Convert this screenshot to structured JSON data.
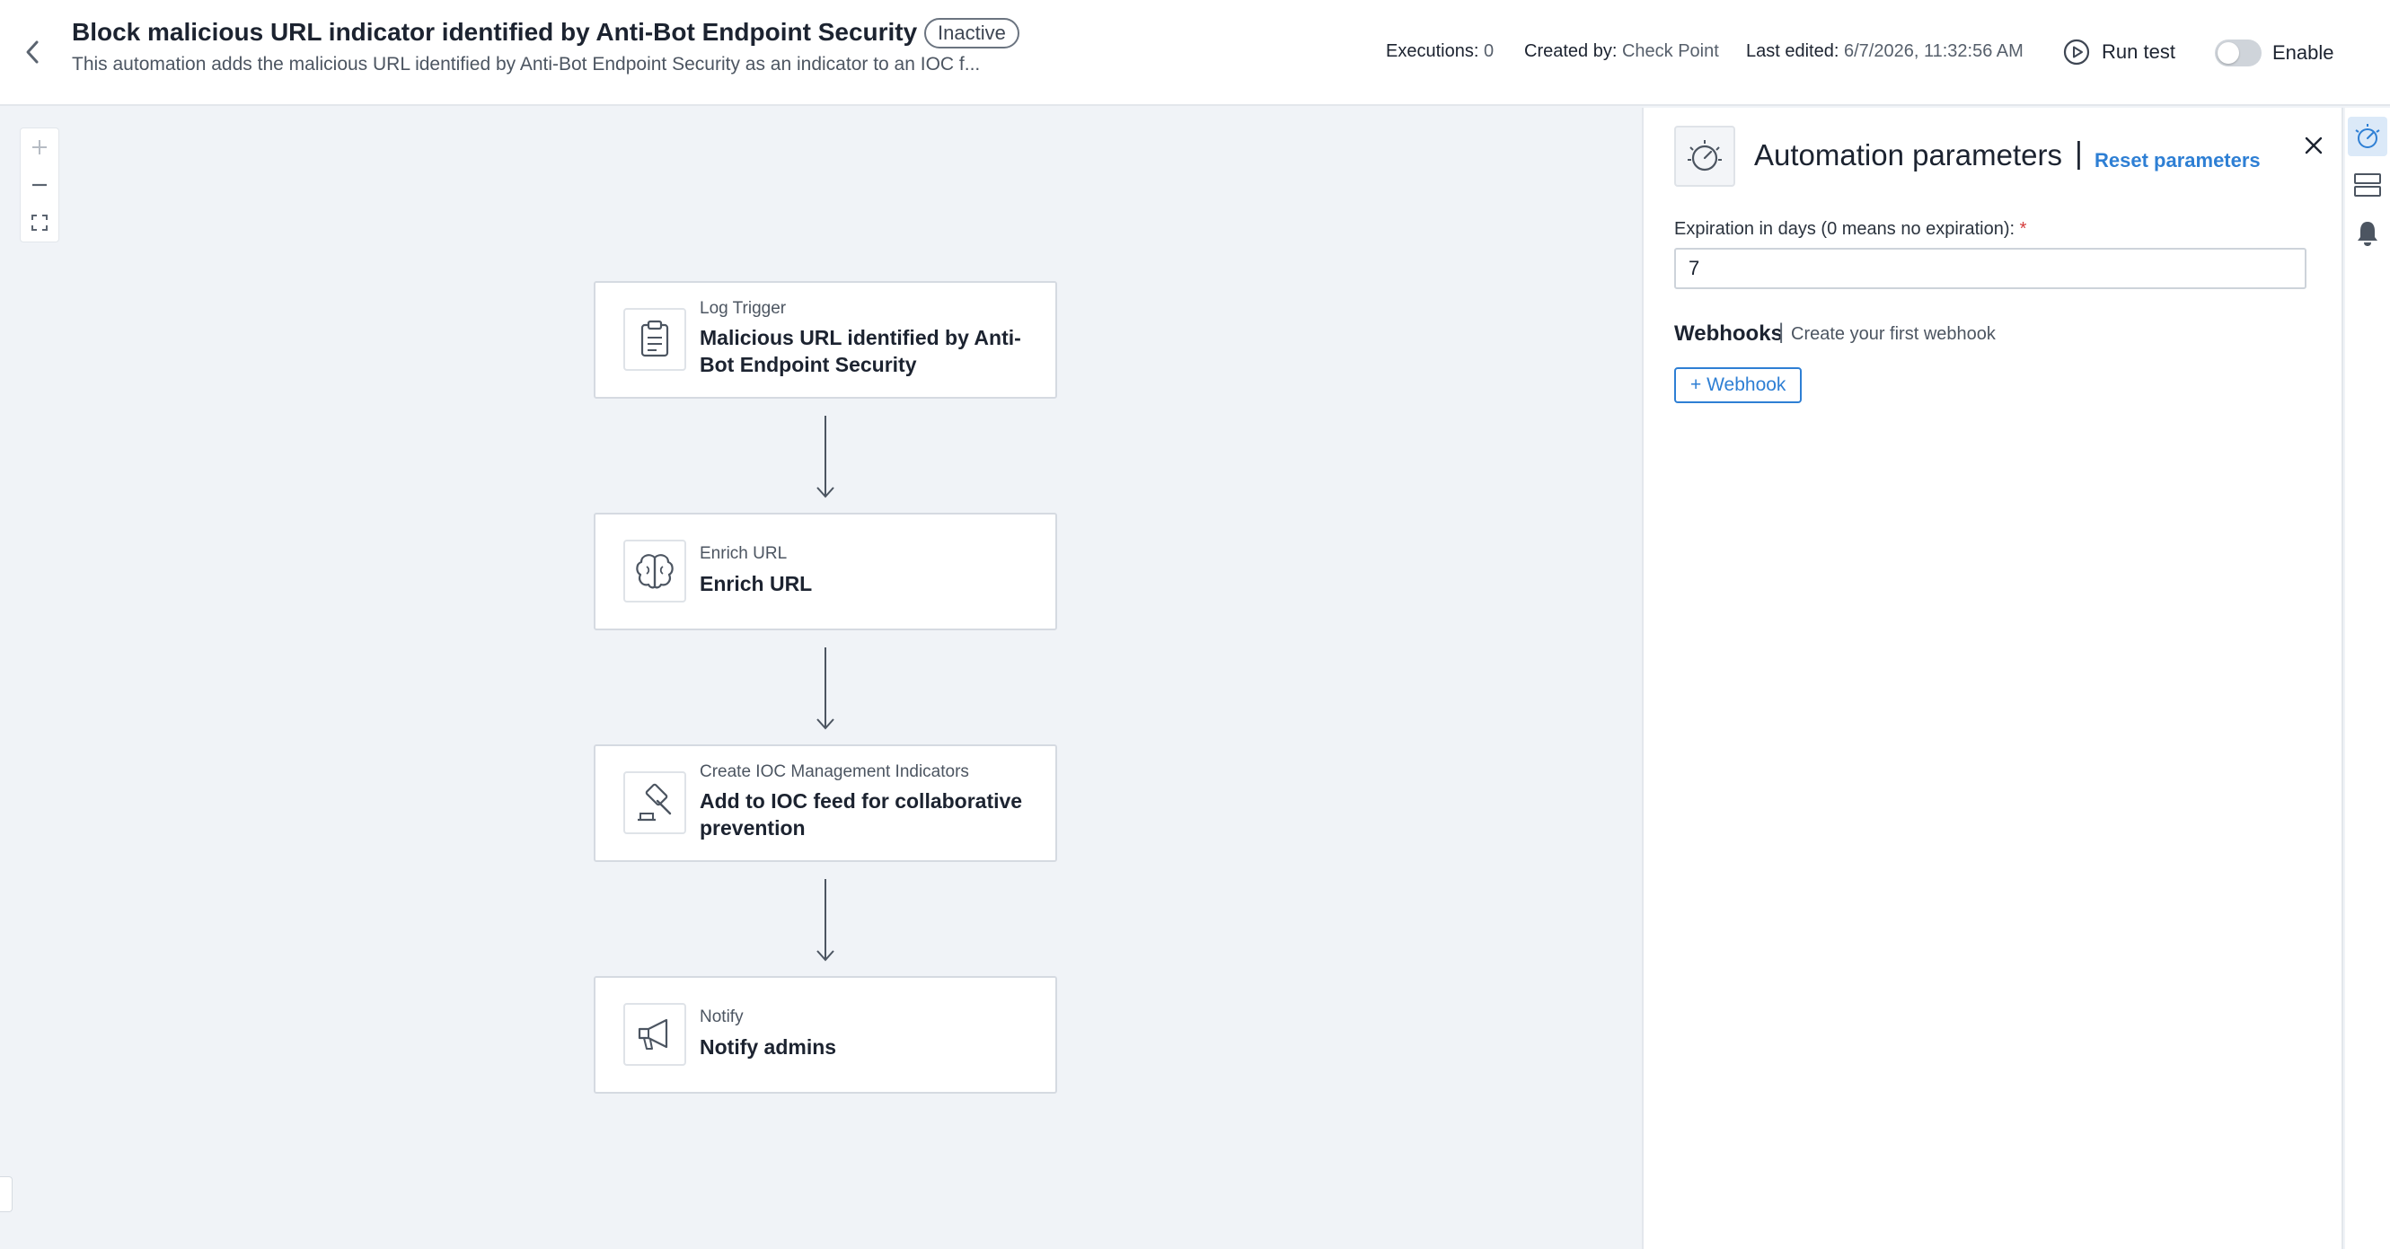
{
  "header": {
    "title": "Block malicious URL indicator identified by Anti-Bot Endpoint Security",
    "status": "Inactive",
    "description": "This automation adds the malicious URL identified by Anti-Bot Endpoint Security as an indicator to an IOC f...",
    "executions_label": "Executions:",
    "executions_value": "0",
    "created_by_label": "Created by:",
    "created_by_value": "Check Point",
    "last_edited_label": "Last edited:",
    "last_edited_value": "6/7/2026, 11:32:56 AM",
    "run_test_label": "Run test",
    "enable_label": "Enable",
    "enabled": false
  },
  "workflow": {
    "nodes": [
      {
        "type": "Log Trigger",
        "name": "Malicious URL identified by Anti-Bot Endpoint Security",
        "icon": "clipboard-icon"
      },
      {
        "type": "Enrich URL",
        "name": "Enrich URL",
        "icon": "brain-icon"
      },
      {
        "type": "Create IOC Management Indicators",
        "name": "Add to IOC feed for collaborative prevention",
        "icon": "gavel-icon"
      },
      {
        "type": "Notify",
        "name": "Notify admins",
        "icon": "megaphone-icon"
      }
    ]
  },
  "panel": {
    "title": "Automation parameters",
    "separator": "|",
    "reset_label": "Reset parameters",
    "expiration_label": "Expiration in days (0 means no expiration):",
    "required_mark": "*",
    "expiration_value": "7",
    "webhooks_title": "Webhooks",
    "webhooks_separator": "|",
    "webhooks_subtitle": "Create your first webhook",
    "add_webhook_label": "+ Webhook"
  },
  "colors": {
    "accent": "#2e7fd4",
    "canvas_bg": "#f0f3f7",
    "required": "#d43c3c",
    "rail_active_bg": "#dbe9f8"
  }
}
